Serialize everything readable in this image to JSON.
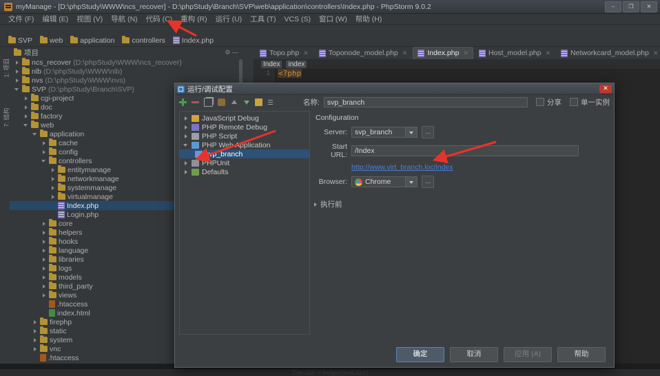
{
  "window": {
    "title": "myManage - [D:\\phpStudy\\WWW\\ncs_recover] - D:\\phpStudy\\Branch\\SVP\\web\\application\\controllers\\Index.php - PhpStorm 9.0.2",
    "icon": "phpstorm-icon",
    "minimize": "–",
    "maximize": "❐",
    "close": "✕"
  },
  "menubar": {
    "items": [
      {
        "label": "文件 (F)"
      },
      {
        "label": "编辑 (E)"
      },
      {
        "label": "视图 (V)"
      },
      {
        "label": "导航 (N)"
      },
      {
        "label": "代码 (C)"
      },
      {
        "label": "重构 (R)"
      },
      {
        "label": "运行 (U)"
      },
      {
        "label": "工具 (T)"
      },
      {
        "label": "VCS (S)"
      },
      {
        "label": "窗口 (W)"
      },
      {
        "label": "帮助 (H)"
      }
    ]
  },
  "breadcrumbs": {
    "items": [
      {
        "label": "SVP",
        "icon": "folder-icon"
      },
      {
        "label": "web",
        "icon": "folder-icon"
      },
      {
        "label": "application",
        "icon": "folder-icon"
      },
      {
        "label": "controllers",
        "icon": "folder-icon"
      },
      {
        "label": "Index.php",
        "icon": "php-file-icon"
      }
    ]
  },
  "rails": {
    "project": "1: 项目",
    "structure": "7: 结构"
  },
  "project_panel": {
    "title": "项目",
    "tree": [
      {
        "label": "ncs_recover",
        "path": "(D:\\phpStudy\\WWW\\ncs_recover)",
        "indent": 0,
        "arrow": "right",
        "icon": "folder-icon",
        "selected": false
      },
      {
        "label": "nlb",
        "path": "(D:\\phpStudy\\WWW\\nlb)",
        "indent": 0,
        "arrow": "right",
        "icon": "folder-icon",
        "selected": false
      },
      {
        "label": "nvs",
        "path": "(D:\\phpStudy\\WWW\\nvs)",
        "indent": 0,
        "arrow": "right",
        "icon": "folder-icon",
        "selected": false
      },
      {
        "label": "SVP",
        "path": "(D:\\phpStudy\\Branch\\SVP)",
        "indent": 0,
        "arrow": "down",
        "icon": "folder-icon",
        "selected": false
      },
      {
        "label": "cgi-project",
        "path": "",
        "indent": 1,
        "arrow": "right",
        "icon": "folder-icon",
        "selected": false
      },
      {
        "label": "doc",
        "path": "",
        "indent": 1,
        "arrow": "right",
        "icon": "folder-icon",
        "selected": false
      },
      {
        "label": "factory",
        "path": "",
        "indent": 1,
        "arrow": "right",
        "icon": "folder-icon",
        "selected": false
      },
      {
        "label": "web",
        "path": "",
        "indent": 1,
        "arrow": "down",
        "icon": "folder-icon",
        "selected": false
      },
      {
        "label": "application",
        "path": "",
        "indent": 2,
        "arrow": "down",
        "icon": "folder-icon",
        "selected": false
      },
      {
        "label": "cache",
        "path": "",
        "indent": 3,
        "arrow": "right",
        "icon": "folder-icon",
        "selected": false
      },
      {
        "label": "config",
        "path": "",
        "indent": 3,
        "arrow": "right",
        "icon": "folder-icon",
        "selected": false
      },
      {
        "label": "controllers",
        "path": "",
        "indent": 3,
        "arrow": "down",
        "icon": "folder-icon",
        "selected": false
      },
      {
        "label": "entitymanage",
        "path": "",
        "indent": 4,
        "arrow": "right",
        "icon": "folder-icon",
        "selected": false
      },
      {
        "label": "networkmanage",
        "path": "",
        "indent": 4,
        "arrow": "right",
        "icon": "folder-icon",
        "selected": false
      },
      {
        "label": "systemmanage",
        "path": "",
        "indent": 4,
        "arrow": "right",
        "icon": "folder-icon",
        "selected": false
      },
      {
        "label": "virtualmanage",
        "path": "",
        "indent": 4,
        "arrow": "right",
        "icon": "folder-icon",
        "selected": false
      },
      {
        "label": "Index.php",
        "path": "",
        "indent": 4,
        "arrow": "none",
        "icon": "php-file-icon",
        "selected": true
      },
      {
        "label": "Login.php",
        "path": "",
        "indent": 4,
        "arrow": "none",
        "icon": "php-file-icon",
        "selected": false
      },
      {
        "label": "core",
        "path": "",
        "indent": 3,
        "arrow": "right",
        "icon": "folder-icon",
        "selected": false
      },
      {
        "label": "helpers",
        "path": "",
        "indent": 3,
        "arrow": "right",
        "icon": "folder-icon",
        "selected": false
      },
      {
        "label": "hooks",
        "path": "",
        "indent": 3,
        "arrow": "right",
        "icon": "folder-icon",
        "selected": false
      },
      {
        "label": "language",
        "path": "",
        "indent": 3,
        "arrow": "right",
        "icon": "folder-icon",
        "selected": false
      },
      {
        "label": "libraries",
        "path": "",
        "indent": 3,
        "arrow": "right",
        "icon": "folder-icon",
        "selected": false
      },
      {
        "label": "logs",
        "path": "",
        "indent": 3,
        "arrow": "right",
        "icon": "folder-icon",
        "selected": false
      },
      {
        "label": "models",
        "path": "",
        "indent": 3,
        "arrow": "right",
        "icon": "folder-icon",
        "selected": false
      },
      {
        "label": "third_party",
        "path": "",
        "indent": 3,
        "arrow": "right",
        "icon": "folder-icon",
        "selected": false
      },
      {
        "label": "views",
        "path": "",
        "indent": 3,
        "arrow": "right",
        "icon": "folder-icon",
        "selected": false
      },
      {
        "label": ".htaccess",
        "path": "",
        "indent": 3,
        "arrow": "none",
        "icon": "htaccess-icon",
        "selected": false
      },
      {
        "label": "index.html",
        "path": "",
        "indent": 3,
        "arrow": "none",
        "icon": "html-file-icon",
        "selected": false
      },
      {
        "label": "firephp",
        "path": "",
        "indent": 2,
        "arrow": "right",
        "icon": "folder-icon",
        "selected": false
      },
      {
        "label": "static",
        "path": "",
        "indent": 2,
        "arrow": "right",
        "icon": "folder-icon",
        "selected": false
      },
      {
        "label": "system",
        "path": "",
        "indent": 2,
        "arrow": "right",
        "icon": "folder-icon",
        "selected": false
      },
      {
        "label": "vnc",
        "path": "",
        "indent": 2,
        "arrow": "right",
        "icon": "folder-icon",
        "selected": false
      },
      {
        "label": ".htaccess",
        "path": "",
        "indent": 2,
        "arrow": "none",
        "icon": "htaccess-icon",
        "selected": false
      }
    ]
  },
  "editor": {
    "tabs": [
      {
        "label": "Topo.php",
        "active": false,
        "icon": "php-file-icon"
      },
      {
        "label": "Toponode_model.php",
        "active": false,
        "icon": "php-file-icon"
      },
      {
        "label": "Index.php",
        "active": true,
        "icon": "php-file-icon"
      },
      {
        "label": "Host_model.php",
        "active": false,
        "icon": "php-file-icon"
      },
      {
        "label": "Networkcard_model.php",
        "active": false,
        "icon": "php-file-icon"
      }
    ],
    "structure_crumb": [
      "Index",
      "index"
    ],
    "lines": [
      {
        "number": "1",
        "text": "<?php"
      }
    ]
  },
  "dialog": {
    "title": "运行/调试配置",
    "close": "✕",
    "toolbar_icons": [
      "add-icon",
      "remove-icon",
      "copy-icon",
      "share-icon",
      "move-up-icon",
      "move-down-icon",
      "folder-icon",
      "sort-icon"
    ],
    "name_label": "名称:",
    "name_value": "svp_branch",
    "checkboxes": [
      {
        "label": "分享",
        "checked": false
      },
      {
        "label": "单一实例",
        "checked": false
      }
    ],
    "config_tree": [
      {
        "label": "JavaScript Debug",
        "arrow": "right",
        "icon": "js",
        "indent": 0,
        "selected": false
      },
      {
        "label": "PHP Remote Debug",
        "arrow": "right",
        "icon": "remote",
        "indent": 0,
        "selected": false
      },
      {
        "label": "PHP Script",
        "arrow": "right",
        "icon": "script",
        "indent": 0,
        "selected": false
      },
      {
        "label": "PHP Web Application",
        "arrow": "down",
        "icon": "web",
        "indent": 0,
        "selected": false
      },
      {
        "label": "svp_branch",
        "arrow": "none",
        "icon": "run",
        "indent": 1,
        "selected": true
      },
      {
        "label": "PHPUnit",
        "arrow": "right",
        "icon": "unit",
        "indent": 0,
        "selected": false
      },
      {
        "label": "Defaults",
        "arrow": "right",
        "icon": "def",
        "indent": 0,
        "selected": false
      }
    ],
    "config": {
      "section_title": "Configuration",
      "server_label": "Server:",
      "server_value": "svp_branch",
      "server_browse": "...",
      "start_url_label": "Start URL:",
      "start_url_value": "/Index",
      "resolved_url": "http://www.virt_branch.loc/index",
      "browser_label": "Browser:",
      "browser_value": "Chrome",
      "browser_browse": "...",
      "before_launch": "执行前"
    },
    "buttons": [
      {
        "label": "确定",
        "style": "default"
      },
      {
        "label": "取消",
        "style": "normal"
      },
      {
        "label": "应用 (A)",
        "style": "disabled"
      },
      {
        "label": "帮助",
        "style": "normal"
      }
    ]
  },
  "annotations": {
    "arrow_color": "#e8332a",
    "arrows": [
      {
        "name": "arrow-to-run-menu"
      },
      {
        "name": "arrow-to-svp-branch-config"
      },
      {
        "name": "arrow-to-resolved-url"
      }
    ]
  },
  "statusbar": {
    "text": "Tree size -> Integer('level size')"
  }
}
